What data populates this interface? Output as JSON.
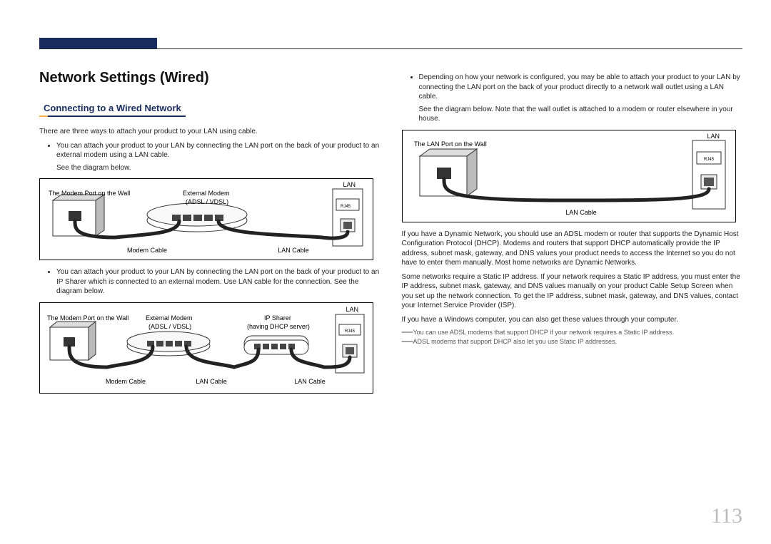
{
  "page_number": "113",
  "heading": "Network Settings (Wired)",
  "subheading": "Connecting to a Wired Network",
  "intro": "There are three ways to attach your product to your LAN using cable.",
  "bullet1a": "You can attach your product to your LAN by connecting the LAN port on the back of your product to an external modem using a LAN cable.",
  "bullet1b": "See the diagram below.",
  "bullet2": "You can attach your product to your LAN by connecting the LAN port on the back of your product to an IP Sharer which is connected to an external modem. Use LAN cable for the connection. See the diagram below.",
  "bullet3a": "Depending on how your network is configured, you may be able to attach your product to your LAN by connecting the LAN port on the back of your product directly to a network wall outlet using a LAN cable.",
  "bullet3b": "See the diagram below. Note that the wall outlet is attached to a modem or router elsewhere in your house.",
  "para_dhcp": "If you have a Dynamic Network, you should use an ADSL modem or router that supports the Dynamic Host Configuration Protocol (DHCP). Modems and routers that support DHCP automatically provide the IP address, subnet mask, gateway, and DNS values your product needs to access the Internet so you do not have to enter them manually. Most home networks are Dynamic Networks.",
  "para_static": "Some networks require a Static IP address. If your network requires a Static IP address, you must enter the IP address, subnet mask, gateway, and DNS values manually on your product Cable Setup Screen when you set up the network connection. To get the IP address, subnet mask, gateway, and DNS values, contact your Internet Service Provider (ISP).",
  "para_windows": "If you have a Windows computer, you can also get these values through your computer.",
  "note1": "You can use ADSL modems that support DHCP if your network requires a Static IP address.",
  "note2": "ADSL modems that support DHCP also let you use Static IP addresses.",
  "fig_labels": {
    "modem_port": "The Modem Port on the Wall",
    "lan_port_wall": "The LAN Port on the Wall",
    "ext_modem": "External Modem",
    "adsl_vdsl": "(ADSL / VDSL)",
    "ip_sharer": "IP Sharer",
    "dhcp_server": "(having DHCP server)",
    "lan": "LAN",
    "rj45": "RJ45",
    "modem_cable": "Modem Cable",
    "lan_cable": "LAN Cable"
  }
}
